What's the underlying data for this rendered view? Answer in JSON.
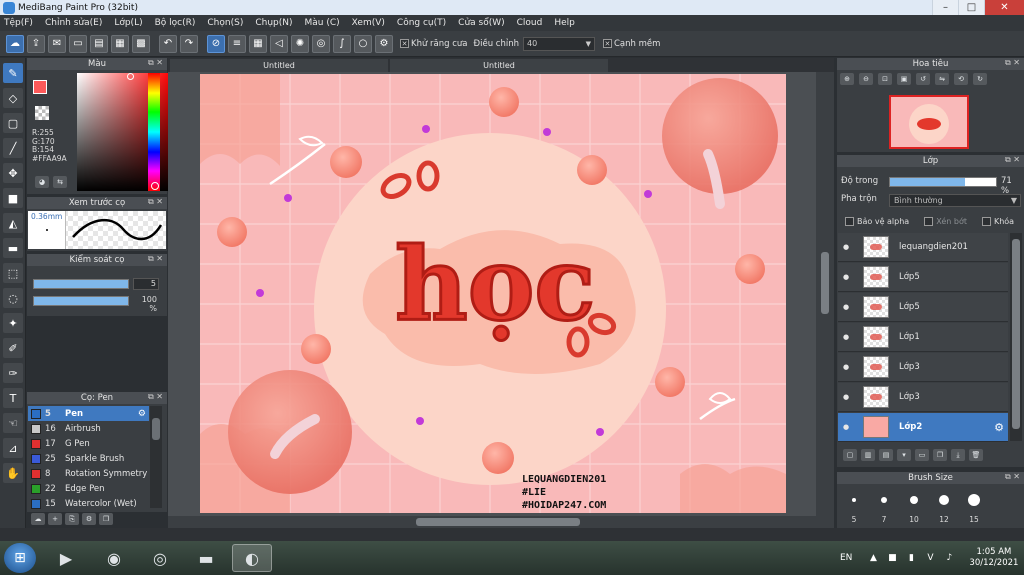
{
  "window": {
    "title": "MediBang Paint Pro (32bit)",
    "controls": [
      "–",
      "□",
      "✕"
    ]
  },
  "menu": [
    "Tệp(F)",
    "Chỉnh sửa(E)",
    "Lớp(L)",
    "Bộ lọc(R)",
    "Chọn(S)",
    "Chụp(N)",
    "Màu (C)",
    "Xem(V)",
    "Công cụ(T)",
    "Cửa sổ(W)",
    "Cloud",
    "Help"
  ],
  "toolbar": {
    "antialias_label": "Khử răng cưa",
    "correction_label": "Điều chỉnh",
    "correction_value": "40",
    "edge_label": "Cạnh mềm"
  },
  "panels": {
    "color": {
      "title": "Màu",
      "values": [
        "R:255",
        "G:170",
        "B:154",
        "#FFAA9A"
      ]
    },
    "brush_preview": {
      "title": "Xem trước cọ",
      "size_label": "0.36mm"
    },
    "brush_control": {
      "title": "Kiểm soát cọ",
      "size_value": "5",
      "size_fraction": 1.0,
      "opacity_value": "100 %",
      "opacity_fraction": 1.0
    },
    "brush_list": {
      "title": "Cọ: Pen",
      "items": [
        {
          "num": "5",
          "name": "Pen",
          "color": "#2b6ec2",
          "selected": true
        },
        {
          "num": "16",
          "name": "Airbrush",
          "color": "#c8c8c8",
          "selected": false
        },
        {
          "num": "17",
          "name": "G Pen",
          "color": "#e03030",
          "selected": false
        },
        {
          "num": "25",
          "name": "Sparkle Brush",
          "color": "#3a5ad8",
          "selected": false
        },
        {
          "num": "8",
          "name": "Rotation Symmetry",
          "color": "#e03030",
          "selected": false
        },
        {
          "num": "22",
          "name": "Edge Pen",
          "color": "#2aa02a",
          "selected": false
        },
        {
          "num": "15",
          "name": "Watercolor (Wet)",
          "color": "#2b6ec2",
          "selected": false
        }
      ]
    },
    "navigator": {
      "title": "Hoa tiêu"
    },
    "layers": {
      "title": "Lớp",
      "opacity_label": "Độ trong",
      "opacity_value": "71 %",
      "opacity_fraction": 0.71,
      "blend_label": "Pha trộn",
      "blend_value": "Bình thường",
      "protect_alpha": "Bảo vệ alpha",
      "clipping": "Xén bớt",
      "lock": "Khóa",
      "items": [
        {
          "name": "lequangdien201",
          "selected": false
        },
        {
          "name": "Lớp5",
          "selected": false
        },
        {
          "name": "Lớp5",
          "selected": false
        },
        {
          "name": "Lớp1",
          "selected": false
        },
        {
          "name": "Lớp3",
          "selected": false
        },
        {
          "name": "Lớp3",
          "selected": false
        },
        {
          "name": "Lớp2",
          "selected": true
        }
      ]
    },
    "brush_size": {
      "title": "Brush Size",
      "sizes": [
        "5",
        "7",
        "10",
        "12",
        "15"
      ]
    }
  },
  "tabs": [
    "Untitled",
    "Untitled"
  ],
  "artwork": {
    "title_text": "học",
    "signature": [
      "LEQUANGDIEN201",
      "#LIE",
      "#HOIDAP247.COM"
    ]
  },
  "taskbar": {
    "lang": "EN",
    "time": "1:05 AM",
    "date": "30/12/2021"
  }
}
